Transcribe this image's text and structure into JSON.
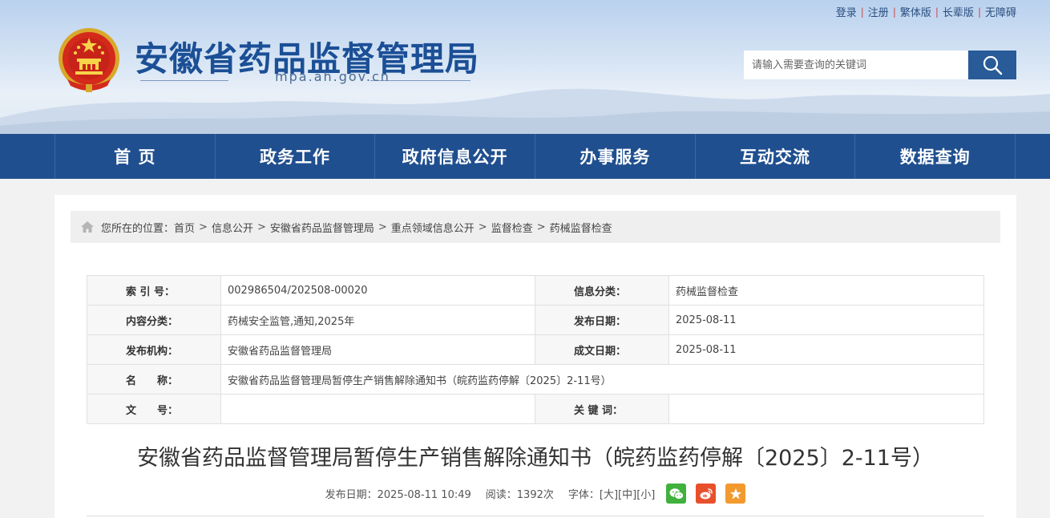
{
  "top_links": [
    {
      "label": "登录"
    },
    {
      "label": "注册"
    },
    {
      "label": "繁体版"
    },
    {
      "label": "长辈版"
    },
    {
      "label": "无障碍"
    }
  ],
  "site": {
    "title": "安徽省药品监督管理局",
    "domain": "mpa.ah.gov.cn"
  },
  "search": {
    "placeholder": "请输入需要查询的关键词"
  },
  "nav": {
    "items": [
      {
        "label": "首 页"
      },
      {
        "label": "政务工作"
      },
      {
        "label": "政府信息公开"
      },
      {
        "label": "办事服务"
      },
      {
        "label": "互动交流"
      },
      {
        "label": "数据查询"
      }
    ]
  },
  "breadcrumb": {
    "prefix": "您所在的位置：",
    "items": [
      "首页",
      "信息公开",
      "安徽省药品监督管理局",
      "重点领域信息公开",
      "监督检查",
      "药械监督检查"
    ]
  },
  "meta": {
    "index_no_label": "索 引 号：",
    "index_no": "002986504/202508-00020",
    "info_class_label": "信息分类：",
    "info_class": "药械监督检查",
    "content_class_label": "内容分类：",
    "content_class": "药械安全监管,通知,2025年",
    "publish_date_label": "发布日期：",
    "publish_date": "2025-08-11",
    "publisher_label": "发布机构：",
    "publisher": "安徽省药品监督管理局",
    "created_date_label": "成文日期：",
    "created_date": "2025-08-11",
    "name_label": "名　　称：",
    "name": "安徽省药品监督管理局暂停生产销售解除通知书（皖药监药停解〔2025〕2-11号）",
    "doc_no_label": "文　　号：",
    "doc_no": "",
    "keywords_label": "关 键 词：",
    "keywords": ""
  },
  "article": {
    "title": "安徽省药品监督管理局暂停生产销售解除通知书（皖药监药停解〔2025〕2-11号）",
    "publish_info": "发布日期：2025-08-11 10:49",
    "reads": "阅读：1392次",
    "font_label": "字体：",
    "font_large": "[大]",
    "font_medium": "[中]",
    "font_small": "[小]"
  },
  "share_icons": [
    "wechat-icon",
    "weibo-icon",
    "favorite-star-icon"
  ],
  "colors": {
    "brand_blue": "#1f4f8f",
    "title_blue": "#1b4f96",
    "wechat_green": "#3fb13c",
    "weibo_red": "#e84f2b",
    "star_orange": "#f29a2e"
  }
}
